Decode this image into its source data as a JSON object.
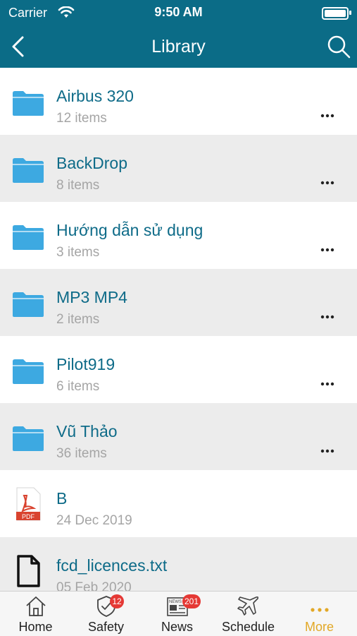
{
  "status_bar": {
    "carrier": "Carrier",
    "time": "9:50 AM"
  },
  "header": {
    "title": "Library"
  },
  "items": [
    {
      "name": "Airbus 320",
      "detail": "12 items",
      "type": "folder"
    },
    {
      "name": "BackDrop",
      "detail": "8 items",
      "type": "folder"
    },
    {
      "name": "Hướng dẫn sử dụng",
      "detail": "3 items",
      "type": "folder"
    },
    {
      "name": "MP3 MP4",
      "detail": "2 items",
      "type": "folder"
    },
    {
      "name": "Pilot919",
      "detail": "6 items",
      "type": "folder"
    },
    {
      "name": "Vũ Thảo",
      "detail": "36 items",
      "type": "folder"
    },
    {
      "name": "B",
      "detail": "24 Dec 2019",
      "type": "pdf",
      "icon_label": "PDF"
    },
    {
      "name": "fcd_licences.txt",
      "detail": "05 Feb 2020",
      "type": "file"
    }
  ],
  "tabs": [
    {
      "label": "Home",
      "icon": "home-icon"
    },
    {
      "label": "Safety",
      "icon": "shield-check-icon",
      "badge": "12"
    },
    {
      "label": "News",
      "icon": "newspaper-icon",
      "badge": "201",
      "icon_text": "NEWS"
    },
    {
      "label": "Schedule",
      "icon": "airplane-icon"
    },
    {
      "label": "More",
      "icon": "more-dots-icon",
      "active": true
    }
  ],
  "colors": {
    "header_bg": "#0b6c87",
    "title_text": "#0e6b88",
    "folder_blue": "#3da9e1",
    "active_tab": "#e2a827",
    "badge_red": "#e53935",
    "pdf_red": "#d9432f"
  }
}
